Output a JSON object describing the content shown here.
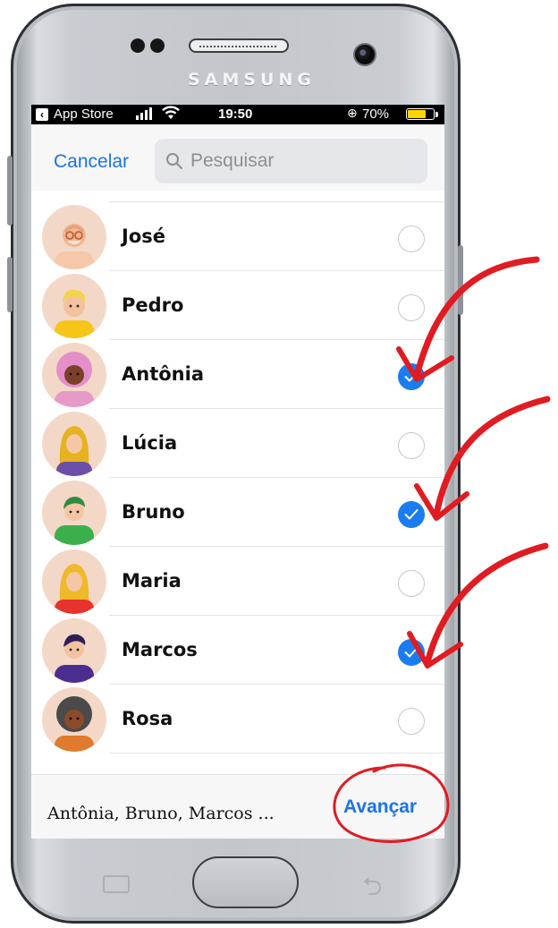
{
  "device": {
    "brand": "SAMSUNG"
  },
  "status_bar": {
    "back_app": "App Store",
    "time": "19:50",
    "battery": "70%",
    "battery_level": 0.7,
    "battery_color": "#ffd400"
  },
  "header": {
    "cancel_label": "Cancelar",
    "search_placeholder": "Pesquisar",
    "search_icon": "magnifier-icon"
  },
  "contacts": [
    {
      "name": "José",
      "selected": false,
      "avatar": "elderly-man-glasses-avatar"
    },
    {
      "name": "Pedro",
      "selected": false,
      "avatar": "blond-man-avatar"
    },
    {
      "name": "Antônia",
      "selected": true,
      "avatar": "pink-hair-woman-avatar"
    },
    {
      "name": "Lúcia",
      "selected": false,
      "avatar": "blonde-woman-avatar"
    },
    {
      "name": "Bruno",
      "selected": true,
      "avatar": "green-shirt-man-avatar"
    },
    {
      "name": "Maria",
      "selected": false,
      "avatar": "blonde-woman-red-avatar"
    },
    {
      "name": "Marcos",
      "selected": true,
      "avatar": "purple-hair-man-avatar"
    },
    {
      "name": "Rosa",
      "selected": false,
      "avatar": "curly-hair-woman-avatar"
    }
  ],
  "footer": {
    "selected_summary": "Antônia, Bruno, Marcos ...",
    "next_label": "Avançar"
  },
  "colors": {
    "accent": "#1a73e8",
    "check": "#1a7cf0",
    "annotation": "#e11b22"
  }
}
